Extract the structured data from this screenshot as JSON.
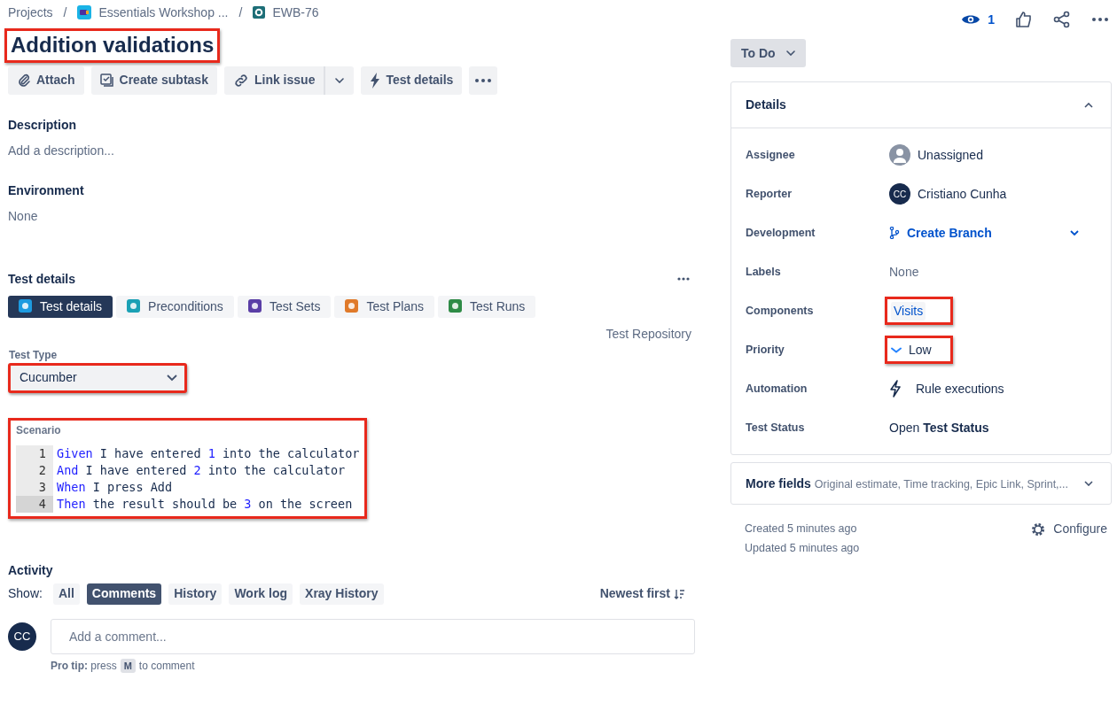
{
  "breadcrumbs": [
    {
      "kind": "text",
      "text": "Projects"
    },
    {
      "kind": "separator",
      "text": "/"
    },
    {
      "kind": "project",
      "text": "Essentials Workshop ..."
    },
    {
      "kind": "separator",
      "text": "/"
    },
    {
      "kind": "issue",
      "text": "EWB-76"
    }
  ],
  "watchers": "1",
  "title": {
    "text": "Addition validations",
    "highlighted": true
  },
  "toolbar": [
    {
      "kind": "attach",
      "label": "Attach"
    },
    {
      "kind": "subtask",
      "label": "Create subtask"
    },
    {
      "kind": "link",
      "label": "Link issue"
    },
    {
      "kind": "bolt",
      "label": "Test details"
    },
    {
      "kind": "more"
    }
  ],
  "description": {
    "heading": "Description",
    "placeholder": "Add a description..."
  },
  "environment": {
    "heading": "Environment",
    "value": "None"
  },
  "test_details": {
    "heading": "Test details",
    "tabs": [
      {
        "label": "Test details",
        "selected": true,
        "color": "#1d9be0"
      },
      {
        "label": "Preconditions",
        "selected": false,
        "color": "#1ba1b5"
      },
      {
        "label": "Test Sets",
        "selected": false,
        "color": "#5a3ea6"
      },
      {
        "label": "Test Plans",
        "selected": false,
        "color": "#e07a2a"
      },
      {
        "label": "Test Runs",
        "selected": false,
        "color": "#2e8b46"
      }
    ],
    "repository_link": "Test Repository",
    "test_type": {
      "label": "Test Type",
      "value": "Cucumber",
      "highlighted": true
    },
    "scenario": {
      "label": "Scenario",
      "highlighted": true,
      "lines": [
        {
          "number": "1",
          "selected": false,
          "tokens": [
            {
              "kind": "keyword",
              "text": "Given"
            },
            {
              "kind": "text",
              "text": " I have entered "
            },
            {
              "kind": "number",
              "text": "1"
            },
            {
              "kind": "text",
              "text": " into the calculator"
            }
          ]
        },
        {
          "number": "2",
          "selected": false,
          "tokens": [
            {
              "kind": "keyword",
              "text": "And"
            },
            {
              "kind": "text",
              "text": " I have entered "
            },
            {
              "kind": "number",
              "text": "2"
            },
            {
              "kind": "text",
              "text": " into the calculator"
            }
          ]
        },
        {
          "number": "3",
          "selected": false,
          "tokens": [
            {
              "kind": "keyword",
              "text": "When"
            },
            {
              "kind": "text",
              "text": " I press Add"
            }
          ]
        },
        {
          "number": "4",
          "selected": true,
          "tokens": [
            {
              "kind": "keyword",
              "text": "Then"
            },
            {
              "kind": "text",
              "text": " the result should be "
            },
            {
              "kind": "number",
              "text": "3"
            },
            {
              "kind": "text",
              "text": " on the screen"
            }
          ]
        }
      ]
    }
  },
  "activity": {
    "heading": "Activity",
    "show_label": "Show:",
    "filters": [
      {
        "label": "All",
        "selected": false
      },
      {
        "label": "Comments",
        "selected": true
      },
      {
        "label": "History",
        "selected": false
      },
      {
        "label": "Work log",
        "selected": false
      },
      {
        "label": "Xray History",
        "selected": false
      }
    ],
    "sort": "Newest first",
    "comment": {
      "avatar": "CC",
      "placeholder": "Add a comment..."
    },
    "pro_tip": {
      "label": "Pro tip:",
      "before": "press",
      "key": "M",
      "after": "to comment"
    }
  },
  "status": "To Do",
  "details": {
    "heading": "Details",
    "expanded": true,
    "fields": [
      {
        "label": "Assignee",
        "kind": "empty-avatar",
        "value": "Unassigned"
      },
      {
        "label": "Reporter",
        "kind": "avatar",
        "avatar": "CC",
        "value": "Cristiano Cunha"
      },
      {
        "label": "Development",
        "kind": "branch",
        "value": "Create Branch"
      },
      {
        "label": "Labels",
        "kind": "muted",
        "value": "None"
      },
      {
        "label": "Components",
        "kind": "tag",
        "value": "Visits",
        "highlighted": true
      },
      {
        "label": "Priority",
        "kind": "priority",
        "value": "Low",
        "highlighted": true
      },
      {
        "label": "Automation",
        "kind": "bolt",
        "value": "Rule executions"
      },
      {
        "label": "Test Status",
        "kind": "plain",
        "value": "Open **Test Status**"
      }
    ]
  },
  "more_fields": {
    "heading": "More fields",
    "summary": "Original estimate, Time tracking, Epic Link, Sprint,..."
  },
  "created": "Created 5 minutes ago",
  "updated": "Updated 5 minutes ago",
  "configure": "Configure"
}
